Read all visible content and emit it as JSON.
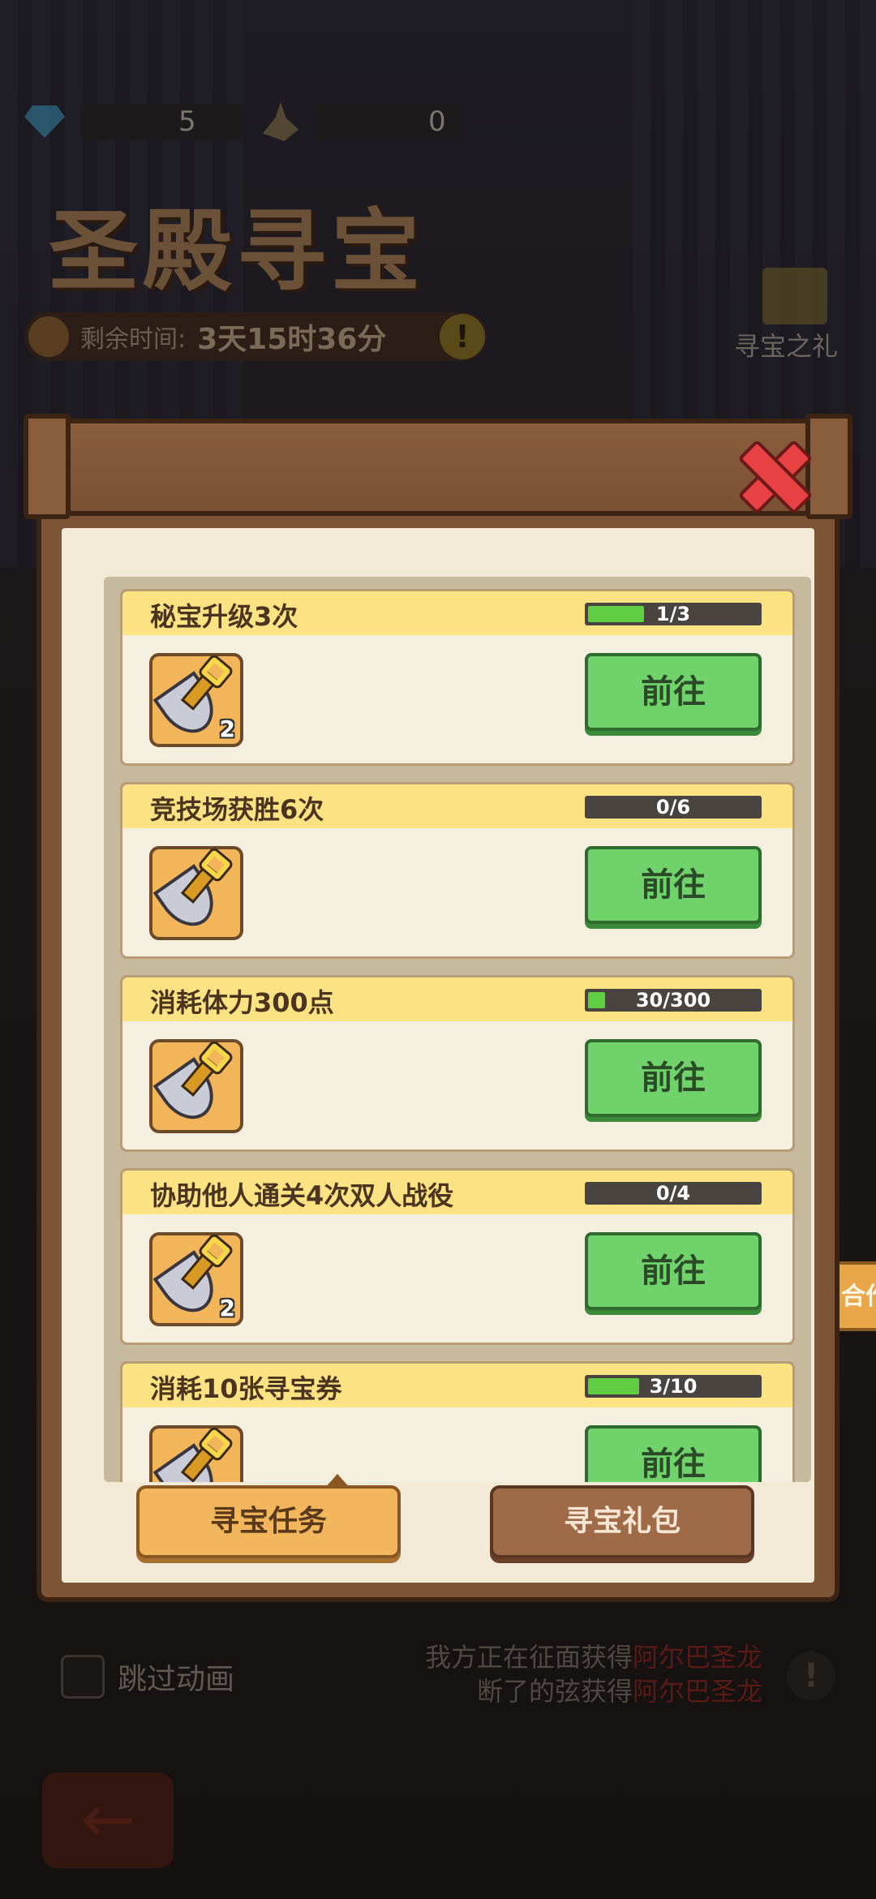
{
  "resources": {
    "gems": "5",
    "shovels": "0"
  },
  "event": {
    "title": "圣殿寻宝",
    "time_label": "剩余时间:",
    "time_value": "3天15时36分",
    "gift_label": "寻宝之礼"
  },
  "skip_label": "跳过动画",
  "ticker": {
    "line1": "我方正在征面获得",
    "line1_highlight": "阿尔巴圣龙",
    "line2": "断了的弦获得",
    "line2_highlight": "阿尔巴圣龙"
  },
  "side_tab_label": "合作",
  "tasks": [
    {
      "title": "秘宝升级3次",
      "progress_text": "1/3",
      "progress": 0.33,
      "reward_qty": "2",
      "button": "前往"
    },
    {
      "title": "竞技场获胜6次",
      "progress_text": "0/6",
      "progress": 0,
      "reward_qty": "",
      "button": "前往"
    },
    {
      "title": "消耗体力300点",
      "progress_text": "30/300",
      "progress": 0.1,
      "reward_qty": "",
      "button": "前往"
    },
    {
      "title": "协助他人通关4次双人战役",
      "progress_text": "0/4",
      "progress": 0,
      "reward_qty": "2",
      "button": "前往"
    },
    {
      "title": "消耗10张寻宝券",
      "progress_text": "3/10",
      "progress": 0.3,
      "reward_qty": "",
      "button": "前往"
    }
  ],
  "tabs": {
    "active": "寻宝任务",
    "inactive": "寻宝礼包"
  },
  "icons": {
    "reward": "shovel-icon",
    "close": "close-icon",
    "gem": "gem-icon",
    "back": "back-arrow-icon",
    "warn": "exclamation-icon"
  },
  "colors": {
    "progress_fill": "#5fce43",
    "go_button": "#6fd26a",
    "close": "#e84143"
  }
}
